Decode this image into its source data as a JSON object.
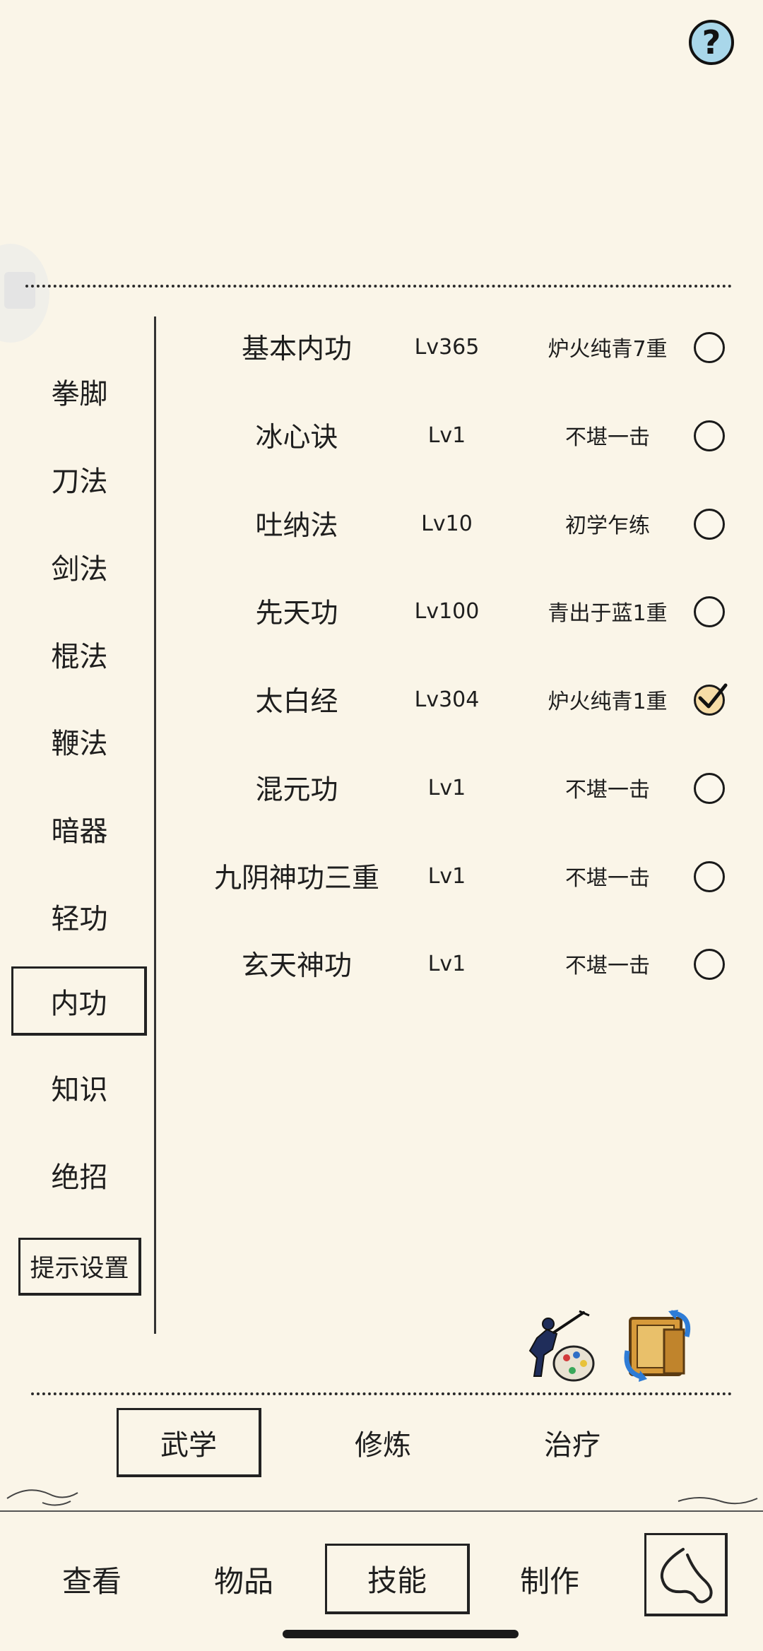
{
  "help": {
    "label": "?"
  },
  "side_nav": {
    "items": [
      {
        "label": "拳脚"
      },
      {
        "label": "刀法"
      },
      {
        "label": "剑法"
      },
      {
        "label": "棍法"
      },
      {
        "label": "鞭法"
      },
      {
        "label": "暗器"
      },
      {
        "label": "轻功"
      },
      {
        "label": "内功",
        "active": true
      },
      {
        "label": "知识"
      },
      {
        "label": "绝招"
      }
    ],
    "hint_settings": "提示设置"
  },
  "skills": [
    {
      "name": "基本内功",
      "level": "Lv365",
      "rank": "炉火纯青7重",
      "equipped": false
    },
    {
      "name": "冰心诀",
      "level": "Lv1",
      "rank": "不堪一击",
      "equipped": false
    },
    {
      "name": "吐纳法",
      "level": "Lv10",
      "rank": "初学乍练",
      "equipped": false
    },
    {
      "name": "先天功",
      "level": "Lv100",
      "rank": "青出于蓝1重",
      "equipped": false
    },
    {
      "name": "太白经",
      "level": "Lv304",
      "rank": "炉火纯青1重",
      "equipped": true
    },
    {
      "name": "混元功",
      "level": "Lv1",
      "rank": "不堪一击",
      "equipped": false
    },
    {
      "name": "九阴神功三重",
      "level": "Lv1",
      "rank": "不堪一击",
      "equipped": false
    },
    {
      "name": "玄天神功",
      "level": "Lv1",
      "rank": "不堪一击",
      "equipped": false
    }
  ],
  "action_icons": [
    "swordsman-paint-icon",
    "book-swap-icon"
  ],
  "sub_tabs": [
    {
      "label": "武学",
      "active": true
    },
    {
      "label": "修炼"
    },
    {
      "label": "治疗"
    }
  ],
  "main_tabs": [
    {
      "label": "查看"
    },
    {
      "label": "物品"
    },
    {
      "label": "技能",
      "active": true
    },
    {
      "label": "制作"
    }
  ],
  "back_icon": "back-swirl-icon"
}
